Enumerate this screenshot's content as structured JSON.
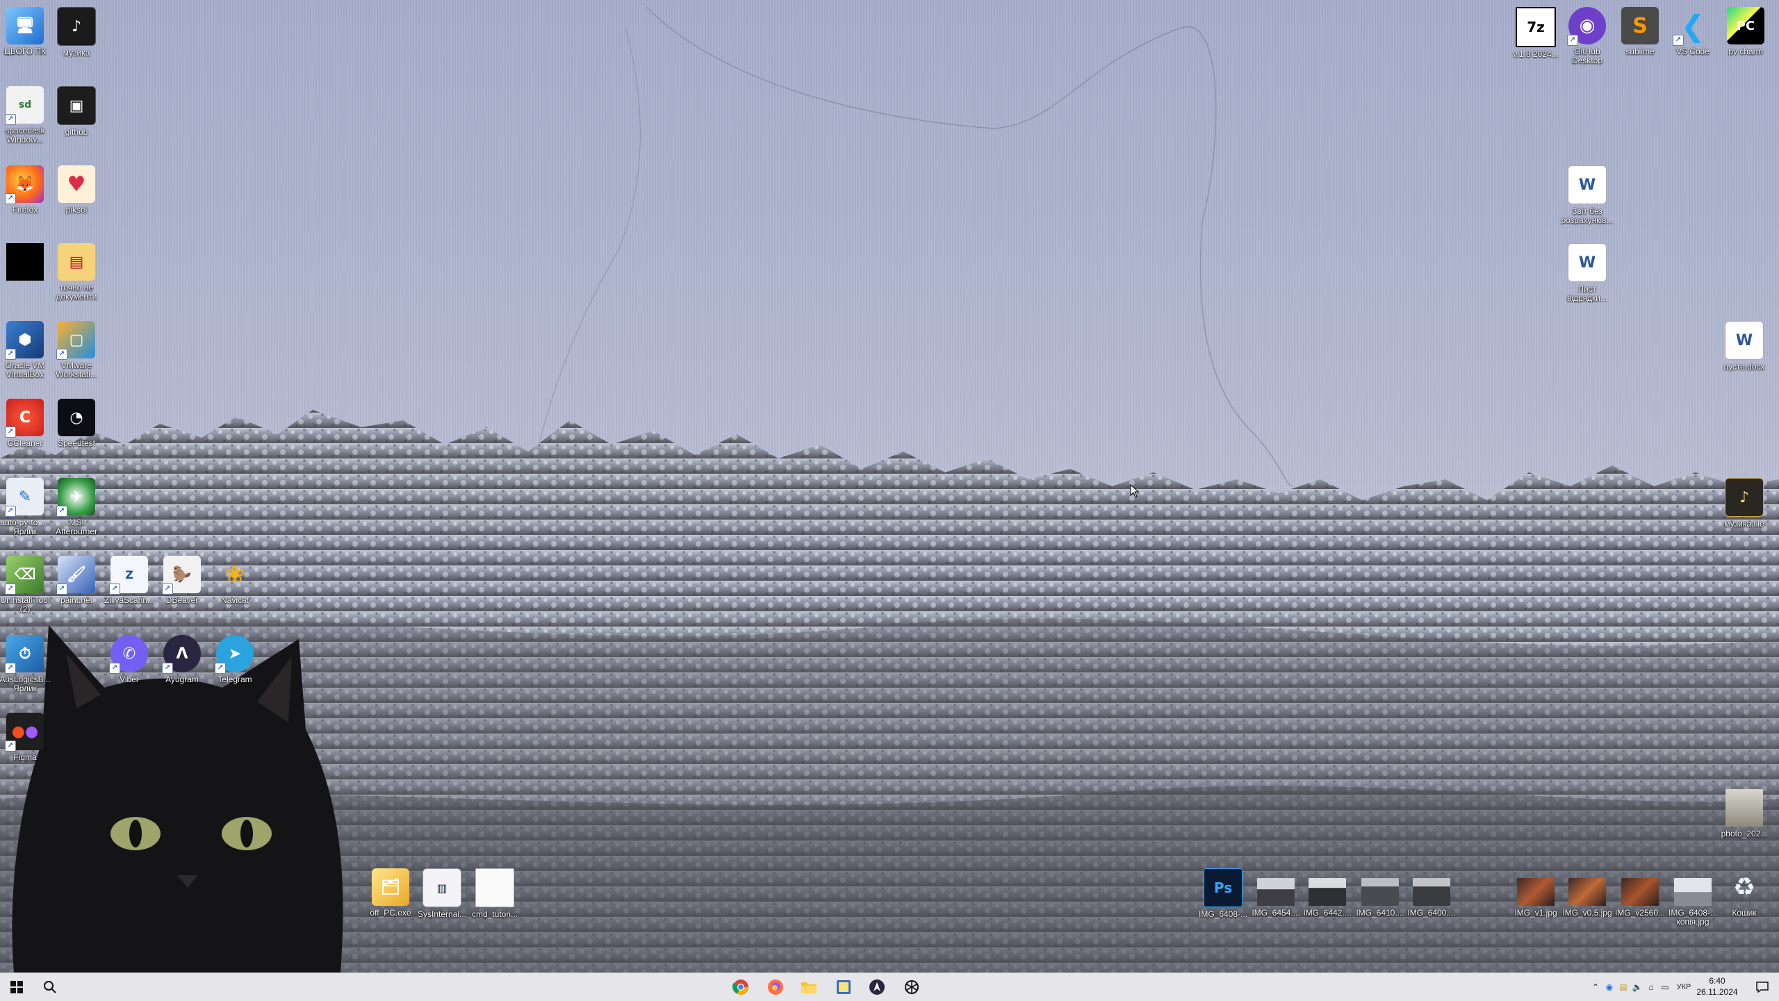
{
  "desktop": {
    "left_icons": [
      {
        "label": "ЦЬОГО ПК",
        "icon": "this-pc-icon"
      },
      {
        "label": "музика",
        "icon": "music-folder-icon"
      },
      {
        "label": "spacedesk Window...",
        "icon": "spacedesk-icon"
      },
      {
        "label": "github",
        "icon": "folder-icon"
      },
      {
        "label": "Firefox",
        "icon": "firefox-icon"
      },
      {
        "label": "piksel",
        "icon": "piksel-icon"
      },
      {
        "label": "",
        "icon": "black-square-icon"
      },
      {
        "label": "точно не документи",
        "icon": "folder-icon"
      },
      {
        "label": "Oracle VM VirtualBox",
        "icon": "virtualbox-icon"
      },
      {
        "label": "VMware Workstati...",
        "icon": "vmware-icon"
      },
      {
        "label": "CCleaner",
        "icon": "ccleaner-icon"
      },
      {
        "label": "Speedtest",
        "icon": "speedtest-icon"
      },
      {
        "label": "auto-py-to... - Ярлик",
        "icon": "auto-py-icon"
      },
      {
        "label": "MSI Afterburner",
        "icon": "afterburner-icon"
      },
      {
        "label": "Uninstall Tool (2)",
        "icon": "uninstall-tool-icon"
      },
      {
        "label": "paint.net",
        "icon": "paintnet-icon"
      },
      {
        "label": "ZillyaScann...",
        "icon": "zillya-icon"
      },
      {
        "label": "DBeaver",
        "icon": "dbeaver-icon"
      },
      {
        "label": "Navicat",
        "icon": "navicat-icon"
      },
      {
        "label": "AusLogicsB... Ярлик",
        "icon": "auslogics-icon"
      },
      {
        "label": "Viber",
        "icon": "viber-icon"
      },
      {
        "label": "Ayugram",
        "icon": "ayugram-icon"
      },
      {
        "label": "Telegram",
        "icon": "telegram-icon"
      },
      {
        "label": "Figma",
        "icon": "figma-icon"
      }
    ],
    "right_icons": [
      {
        "label": "v.1.8 2024...",
        "icon": "7zip-icon",
        "badge": "7z"
      },
      {
        "label": "GitHub Desktop",
        "icon": "github-desktop-icon"
      },
      {
        "label": "sublime",
        "icon": "sublime-icon",
        "badge": "S"
      },
      {
        "label": "VS Code",
        "icon": "vscode-icon"
      },
      {
        "label": "py charm",
        "icon": "pycharm-icon",
        "badge": "PC"
      },
      {
        "label": "Звіт без розрахунків...",
        "icon": "word-doc-icon"
      },
      {
        "label": "Лист відрядки...",
        "icon": "word-doc-icon"
      },
      {
        "label": "пусте.docx",
        "icon": "word-icon"
      },
      {
        "label": "музика.file",
        "icon": "music-file-icon"
      },
      {
        "label": "photo_202...",
        "icon": "photo-thumb-icon"
      }
    ],
    "bottom_icons": [
      {
        "label": "off_PC.exe",
        "icon": "exe-icon"
      },
      {
        "label": "SysInternal...",
        "icon": "sysinternals-icon"
      },
      {
        "label": "cmd_tutori...",
        "icon": "text-file-icon"
      },
      {
        "label": "IMG_6408-...",
        "icon": "photoshop-psd-icon",
        "badge": "Ps"
      },
      {
        "label": "IMG_6454....",
        "icon": "image-thumb-icon"
      },
      {
        "label": "IMG_6442....",
        "icon": "image-thumb-icon"
      },
      {
        "label": "IMG_6410....",
        "icon": "image-thumb-icon"
      },
      {
        "label": "IMG_6400....",
        "icon": "image-thumb-icon"
      },
      {
        "label": "IMG_v1.jpg",
        "icon": "image-thumb-icon"
      },
      {
        "label": "IMG_v0,5.jpg",
        "icon": "image-thumb-icon"
      },
      {
        "label": "IMG_v2560...",
        "icon": "image-thumb-icon"
      },
      {
        "label": "IMG_6408-... копія.jpg",
        "icon": "image-thumb-icon"
      },
      {
        "label": "Кошик",
        "icon": "recycle-bin-icon"
      }
    ]
  },
  "taskbar": {
    "start": "windows-start-icon",
    "search": "search-icon",
    "pinned": [
      "chrome-icon",
      "firefox-icon",
      "file-explorer-icon",
      "notes-icon",
      "ayugram-icon",
      "chatgpt-icon"
    ],
    "tray": {
      "language": "УКР",
      "chevron": "chevron-up-icon"
    },
    "clock": {
      "time": "6:40",
      "date": "26.11.2024"
    }
  }
}
